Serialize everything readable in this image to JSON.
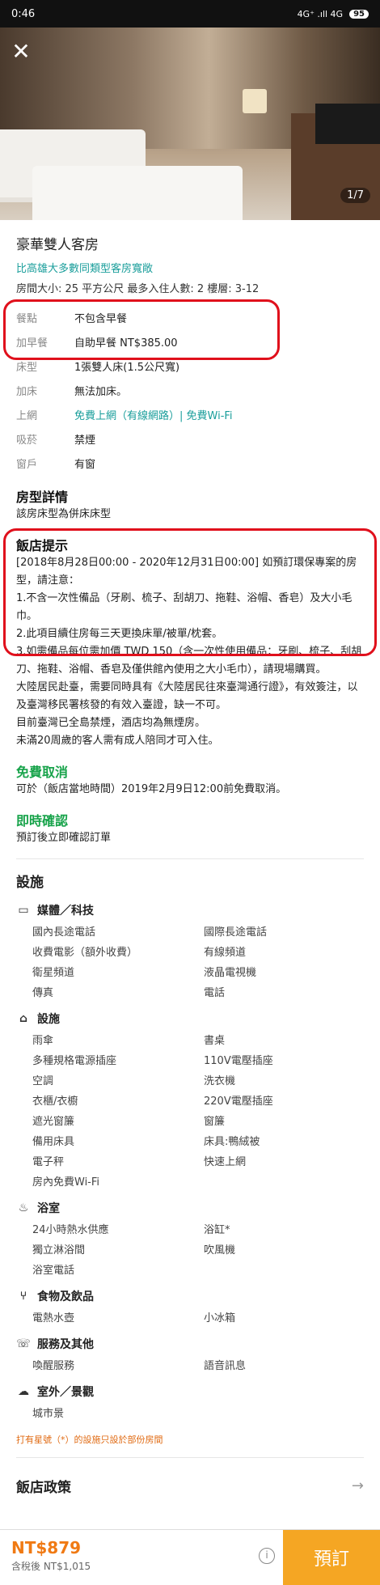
{
  "status": {
    "time": "0:46",
    "network": "4G⁺ .ıll 4G",
    "battery": "95"
  },
  "gallery": {
    "counter": "1/7"
  },
  "room": {
    "title": "豪華雙人客房",
    "subtitle": "比高雄大多數同類型客房寬敞",
    "meta": "房間大小: 25 平方公尺   最多入住人數: 2   樓層: 3-12"
  },
  "specs": [
    {
      "key": "餐點",
      "value": "不包含早餐",
      "green": false
    },
    {
      "key": "加早餐",
      "value": "自助早餐 NT$385.00",
      "green": false
    },
    {
      "key": "床型",
      "value": "1張雙人床(1.5公尺寬)",
      "green": false
    },
    {
      "key": "加床",
      "value": "無法加床。",
      "green": false
    },
    {
      "key": "上網",
      "value": "免費上網（有線網路）| 免費Wi-Fi",
      "green": true
    },
    {
      "key": "吸菸",
      "value": "禁煙",
      "green": false
    },
    {
      "key": "窗戶",
      "value": "有窗",
      "green": false
    }
  ],
  "room_details": {
    "title": "房型詳情",
    "text": "該房床型為併床床型"
  },
  "hotel_notice": {
    "title": "飯店提示",
    "lines": [
      "[2018年8月28日00:00 - 2020年12月31日00:00] 如預訂環保專案的房型，請注意：",
      "1.不含一次性備品（牙刷、梳子、刮胡刀、拖鞋、浴帽、香皂）及大小毛巾。",
      "2.此項目續住房每三天更換床單/被單/枕套。",
      "3.如需備品每位需加價 TWD 150（含一次性使用備品：牙刷、梳子、刮胡刀、拖鞋、浴帽、香皂及僅供館內使用之大小毛巾），請現場購買。",
      "大陸居民赴臺，需要同時具有《大陸居民往來臺灣通行證》，有效簽注，以及臺灣移民署核發的有效入臺證，缺一不可。",
      "目前臺灣已全島禁煙，酒店均為無煙房。",
      "未滿20周歲的客人需有成人陪同才可入住。"
    ]
  },
  "free_cancel": {
    "title": "免費取消",
    "text": "可於（飯店當地時間）2019年2月9日12:00前免費取消。"
  },
  "instant_confirm": {
    "title": "即時確認",
    "text": "預訂後立即確認訂單"
  },
  "facilities": {
    "title": "設施",
    "groups": [
      {
        "name": "媒體／科技",
        "icon": "tv-icon",
        "items": [
          "國內長途電話",
          "國際長途電話",
          "收費電影（額外收費）",
          "有線頻道",
          "衛星頻道",
          "液晶電視機",
          "傳真",
          "電話"
        ]
      },
      {
        "name": "設施",
        "icon": "home-icon",
        "items": [
          "雨傘",
          "書桌",
          "多種規格電源插座",
          "110V電壓插座",
          "空調",
          "洗衣機",
          "衣櫃/衣櫥",
          "220V電壓插座",
          "遮光窗簾",
          "窗簾",
          "備用床具",
          "床具:鴨絨被",
          "電子秤",
          "快速上網",
          "房內免費Wi-Fi"
        ]
      },
      {
        "name": "浴室",
        "icon": "bathtub-icon",
        "items": [
          "24小時熱水供應",
          "浴缸*",
          "獨立淋浴間",
          "吹風機",
          "浴室電話"
        ]
      },
      {
        "name": "食物及飲品",
        "icon": "utensils-icon",
        "items": [
          "電熱水壺",
          "小冰箱"
        ]
      },
      {
        "name": "服務及其他",
        "icon": "service-icon",
        "items": [
          "喚醒服務",
          "語音訊息"
        ]
      },
      {
        "name": "室外／景觀",
        "icon": "landscape-icon",
        "items": [
          "城市景"
        ]
      }
    ],
    "footnote": "打有星號（*）的設施只設於部份房間"
  },
  "policy": {
    "title": "飯店政策"
  },
  "booking": {
    "price": "NT$879",
    "tax": "含稅後 NT$1,015",
    "button": "預訂"
  },
  "colors": {
    "accent_green": "#17a34a",
    "teal": "#1a9e9b",
    "orange": "#f5a623",
    "highlight_red": "#e0101c"
  }
}
